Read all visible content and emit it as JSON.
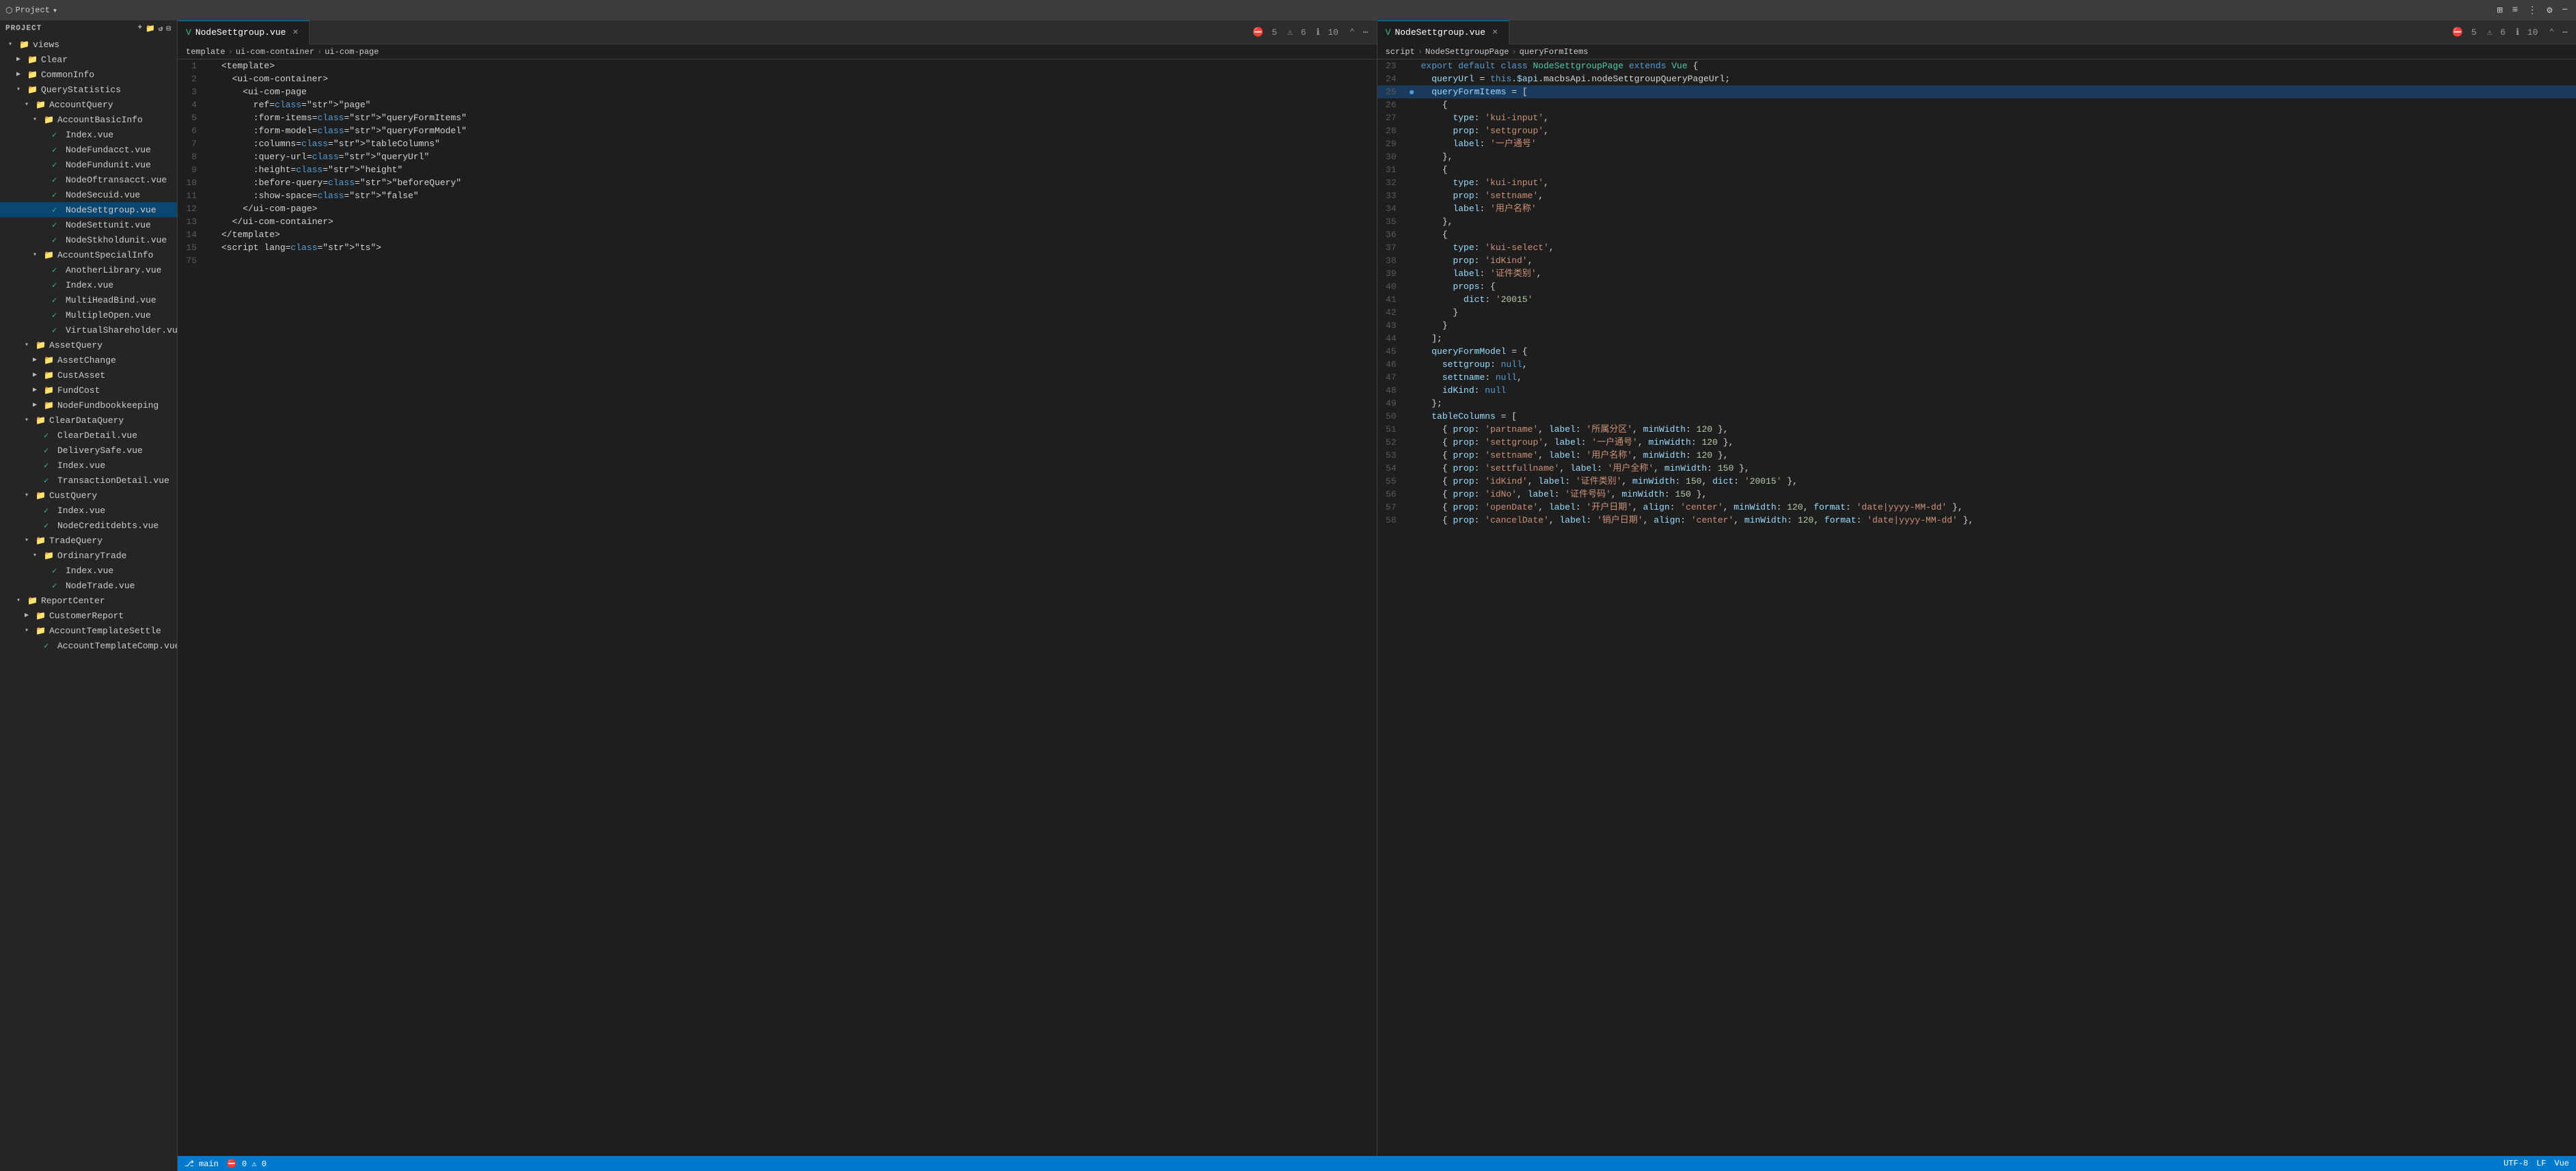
{
  "titleBar": {
    "projectLabel": "Project",
    "icons": [
      "grid-icon",
      "list-icon",
      "dots-icon",
      "settings-icon",
      "minus-icon"
    ]
  },
  "sidebar": {
    "header": "Project",
    "tree": [
      {
        "id": "views",
        "level": 1,
        "type": "folder",
        "label": "views",
        "expanded": true,
        "arrow": "▾"
      },
      {
        "id": "clear",
        "level": 2,
        "type": "folder",
        "label": "Clear",
        "expanded": false,
        "arrow": "▶"
      },
      {
        "id": "commoninfo",
        "level": 2,
        "type": "folder",
        "label": "CommonInfo",
        "expanded": false,
        "arrow": "▶"
      },
      {
        "id": "querystatistics",
        "level": 2,
        "type": "folder",
        "label": "QueryStatistics",
        "expanded": true,
        "arrow": "▾"
      },
      {
        "id": "accountquery",
        "level": 3,
        "type": "folder",
        "label": "AccountQuery",
        "expanded": true,
        "arrow": "▾"
      },
      {
        "id": "accountbasicinfo",
        "level": 4,
        "type": "folder",
        "label": "AccountBasicInfo",
        "expanded": true,
        "arrow": "▾"
      },
      {
        "id": "index-vue-1",
        "level": 5,
        "type": "vue",
        "label": "Index.vue"
      },
      {
        "id": "nodefundacct-vue",
        "level": 5,
        "type": "vue",
        "label": "NodeFundacct.vue"
      },
      {
        "id": "nodefundunit-vue",
        "level": 5,
        "type": "vue",
        "label": "NodeFundunit.vue"
      },
      {
        "id": "nodeoftransacct-vue",
        "level": 5,
        "type": "vue",
        "label": "NodeOftransacct.vue"
      },
      {
        "id": "nodesecuid-vue",
        "level": 5,
        "type": "vue",
        "label": "NodeSecuid.vue"
      },
      {
        "id": "nodesettgroup-vue",
        "level": 5,
        "type": "vue",
        "label": "NodeSettgroup.vue",
        "selected": true
      },
      {
        "id": "nodesetunit-vue",
        "level": 5,
        "type": "vue",
        "label": "NodeSettunit.vue"
      },
      {
        "id": "nodestkholdunit-vue",
        "level": 5,
        "type": "vue",
        "label": "NodeStkholdunit.vue"
      },
      {
        "id": "accountspecialinfo",
        "level": 4,
        "type": "folder",
        "label": "AccountSpecialInfo",
        "expanded": true,
        "arrow": "▾"
      },
      {
        "id": "anotherlibrary-vue",
        "level": 5,
        "type": "vue",
        "label": "AnotherLibrary.vue"
      },
      {
        "id": "index-vue-2",
        "level": 5,
        "type": "vue",
        "label": "Index.vue"
      },
      {
        "id": "multiheadbind-vue",
        "level": 5,
        "type": "vue",
        "label": "MultiHeadBind.vue"
      },
      {
        "id": "multipleopen-vue",
        "level": 5,
        "type": "vue",
        "label": "MultipleOpen.vue"
      },
      {
        "id": "virtualshareholder-vue",
        "level": 5,
        "type": "vue",
        "label": "VirtualShareholder.vue"
      },
      {
        "id": "assetquery",
        "level": 3,
        "type": "folder",
        "label": "AssetQuery",
        "expanded": true,
        "arrow": "▾"
      },
      {
        "id": "assetchange",
        "level": 4,
        "type": "folder",
        "label": "AssetChange",
        "expanded": false,
        "arrow": "▶"
      },
      {
        "id": "custasset",
        "level": 4,
        "type": "folder",
        "label": "CustAsset",
        "expanded": false,
        "arrow": "▶"
      },
      {
        "id": "fundcost",
        "level": 4,
        "type": "folder",
        "label": "FundCost",
        "expanded": false,
        "arrow": "▶"
      },
      {
        "id": "nodefundbookkeeping",
        "level": 4,
        "type": "folder",
        "label": "NodeFundbookkeeping",
        "expanded": false,
        "arrow": "▶"
      },
      {
        "id": "cleardataquery",
        "level": 3,
        "type": "folder",
        "label": "ClearDataQuery",
        "expanded": true,
        "arrow": "▾"
      },
      {
        "id": "cleardetail-vue",
        "level": 4,
        "type": "vue",
        "label": "ClearDetail.vue"
      },
      {
        "id": "deliverysafe-vue",
        "level": 4,
        "type": "vue",
        "label": "DeliverySafe.vue"
      },
      {
        "id": "index-vue-3",
        "level": 4,
        "type": "vue",
        "label": "Index.vue"
      },
      {
        "id": "transactiondetail-vue",
        "level": 4,
        "type": "vue",
        "label": "TransactionDetail.vue"
      },
      {
        "id": "custquery",
        "level": 3,
        "type": "folder",
        "label": "CustQuery",
        "expanded": true,
        "arrow": "▾"
      },
      {
        "id": "index-vue-4",
        "level": 4,
        "type": "vue",
        "label": "Index.vue"
      },
      {
        "id": "nodecreditdebts-vue",
        "level": 4,
        "type": "vue",
        "label": "NodeCreditdebts.vue"
      },
      {
        "id": "tradequery",
        "level": 3,
        "type": "folder",
        "label": "TradeQuery",
        "expanded": true,
        "arrow": "▾"
      },
      {
        "id": "ordinarytrade",
        "level": 4,
        "type": "folder",
        "label": "OrdinaryTrade",
        "expanded": true,
        "arrow": "▾"
      },
      {
        "id": "index-vue-5",
        "level": 5,
        "type": "vue",
        "label": "Index.vue"
      },
      {
        "id": "nodetrade-vue",
        "level": 5,
        "type": "vue",
        "label": "NodeTrade.vue"
      },
      {
        "id": "reportcenter",
        "level": 2,
        "type": "folder",
        "label": "ReportCenter",
        "expanded": true,
        "arrow": "▾"
      },
      {
        "id": "customerreport",
        "level": 3,
        "type": "folder",
        "label": "CustomerReport",
        "expanded": false,
        "arrow": "▶"
      },
      {
        "id": "accounttemplatesettle",
        "level": 3,
        "type": "folder",
        "label": "AccountTemplateSettle",
        "expanded": true,
        "arrow": "▾"
      },
      {
        "id": "accounttemplatecomp-vue",
        "level": 4,
        "type": "vue",
        "label": "AccountTemplateComp.vue"
      }
    ]
  },
  "leftEditor": {
    "tab": {
      "label": "NodeSettgroup.vue",
      "modified": false,
      "active": true
    },
    "badges": {
      "errors": "5",
      "warnings": "6",
      "info": "10"
    },
    "lines": [
      {
        "num": 1,
        "code": "<template>",
        "tokens": [
          {
            "t": "tag",
            "v": "<template>"
          }
        ]
      },
      {
        "num": 2,
        "code": "  <ui-com-container>",
        "tokens": [
          {
            "t": "op",
            "v": "  "
          },
          {
            "t": "tag",
            "v": "<ui-com-container>"
          }
        ]
      },
      {
        "num": 3,
        "code": "    <ui-com-page",
        "tokens": [
          {
            "t": "op",
            "v": "    "
          },
          {
            "t": "tag",
            "v": "<ui-com-page"
          }
        ]
      },
      {
        "num": 4,
        "code": "      ref=\"page\"",
        "tokens": [
          {
            "t": "op",
            "v": "      "
          },
          {
            "t": "attr",
            "v": "ref"
          },
          {
            "t": "op",
            "v": "="
          },
          {
            "t": "str",
            "v": "\"page\""
          }
        ]
      },
      {
        "num": 5,
        "code": "      :form-items=\"queryFormItems\"",
        "tokens": [
          {
            "t": "op",
            "v": "      "
          },
          {
            "t": "attr",
            "v": ":form-items"
          },
          {
            "t": "op",
            "v": "="
          },
          {
            "t": "str",
            "v": "\"queryFormItems\""
          }
        ]
      },
      {
        "num": 6,
        "code": "      :form-model=\"queryFormModel\"",
        "tokens": [
          {
            "t": "op",
            "v": "      "
          },
          {
            "t": "attr",
            "v": ":form-model"
          },
          {
            "t": "op",
            "v": "="
          },
          {
            "t": "str",
            "v": "\"queryFormModel\""
          }
        ]
      },
      {
        "num": 7,
        "code": "      :columns=\"tableColumns\"",
        "tokens": [
          {
            "t": "op",
            "v": "      "
          },
          {
            "t": "attr",
            "v": ":columns"
          },
          {
            "t": "op",
            "v": "="
          },
          {
            "t": "str",
            "v": "\"tableColumns\""
          }
        ]
      },
      {
        "num": 8,
        "code": "      :query-url=\"queryUrl\"",
        "tokens": [
          {
            "t": "op",
            "v": "      "
          },
          {
            "t": "attr",
            "v": ":query-url"
          },
          {
            "t": "op",
            "v": "="
          },
          {
            "t": "str",
            "v": "\"queryUrl\""
          }
        ]
      },
      {
        "num": 9,
        "code": "      :height=\"height\"",
        "tokens": [
          {
            "t": "op",
            "v": "      "
          },
          {
            "t": "attr",
            "v": ":height"
          },
          {
            "t": "op",
            "v": "="
          },
          {
            "t": "str",
            "v": "\"height\""
          }
        ]
      },
      {
        "num": 10,
        "code": "      :before-query=\"beforeQuery\"",
        "tokens": [
          {
            "t": "op",
            "v": "      "
          },
          {
            "t": "attr",
            "v": ":before-query"
          },
          {
            "t": "op",
            "v": "="
          },
          {
            "t": "str",
            "v": "\"beforeQuery\""
          }
        ]
      },
      {
        "num": 11,
        "code": "      :show-space=\"false\"",
        "tokens": [
          {
            "t": "op",
            "v": "      "
          },
          {
            "t": "attr",
            "v": ":show-space"
          },
          {
            "t": "op",
            "v": "="
          },
          {
            "t": "str",
            "v": "\"false\""
          }
        ]
      },
      {
        "num": 12,
        "code": "    </ui-com-page>",
        "tokens": [
          {
            "t": "op",
            "v": "    "
          },
          {
            "t": "tag",
            "v": "</ui-com-page>"
          }
        ]
      },
      {
        "num": 13,
        "code": "  </ui-com-container>",
        "tokens": [
          {
            "t": "op",
            "v": "  "
          },
          {
            "t": "tag",
            "v": "</ui-com-container>"
          }
        ]
      },
      {
        "num": 14,
        "code": "</template>",
        "tokens": [
          {
            "t": "tag",
            "v": "</template>"
          }
        ]
      },
      {
        "num": 15,
        "code": "<script lang=\"ts\">",
        "tokens": [
          {
            "t": "tag",
            "v": "<script"
          },
          {
            "t": "op",
            "v": " "
          },
          {
            "t": "attr",
            "v": "lang"
          },
          {
            "t": "op",
            "v": "="
          },
          {
            "t": "str",
            "v": "\"ts\""
          },
          {
            "t": "tag",
            "v": ">"
          }
        ]
      },
      {
        "num": 75,
        "code": ""
      },
      {
        "num": "",
        "code": ""
      }
    ],
    "breadcrumb": [
      "template",
      "ui-com-container",
      "ui-com-page"
    ]
  },
  "rightEditor": {
    "tab": {
      "label": "NodeSettgroup.vue",
      "modified": false,
      "active": true
    },
    "badges": {
      "errors": "5",
      "warnings": "6",
      "info": "10"
    },
    "lines": [
      {
        "num": 23,
        "code": "export default class NodeSettgroupPage extends Vue {",
        "highlight": false
      },
      {
        "num": 24,
        "code": "  queryUrl = this.$api.macbsApi.nodeSettgroupQueryPageUrl;",
        "highlight": false
      },
      {
        "num": 25,
        "code": "  queryFormItems = [",
        "highlight": true
      },
      {
        "num": 26,
        "code": "    {",
        "highlight": false
      },
      {
        "num": 27,
        "code": "      type: 'kui-input',",
        "highlight": false
      },
      {
        "num": 28,
        "code": "      prop: 'settgroup',",
        "highlight": false
      },
      {
        "num": 29,
        "code": "      label: '一户通号'",
        "highlight": false
      },
      {
        "num": 30,
        "code": "    },",
        "highlight": false
      },
      {
        "num": 31,
        "code": "    {",
        "highlight": false
      },
      {
        "num": 32,
        "code": "      type: 'kui-input',",
        "highlight": false
      },
      {
        "num": 33,
        "code": "      prop: 'settname',",
        "highlight": false
      },
      {
        "num": 34,
        "code": "      label: '用户名称'",
        "highlight": false
      },
      {
        "num": 35,
        "code": "    },",
        "highlight": false
      },
      {
        "num": 36,
        "code": "    {",
        "highlight": false
      },
      {
        "num": 37,
        "code": "      type: 'kui-select',",
        "highlight": false
      },
      {
        "num": 38,
        "code": "      prop: 'idKind',",
        "highlight": false
      },
      {
        "num": 39,
        "code": "      label: '证件类别',",
        "highlight": false
      },
      {
        "num": 40,
        "code": "      props: {",
        "highlight": false
      },
      {
        "num": 41,
        "code": "        dict: '20015'",
        "highlight": false
      },
      {
        "num": 42,
        "code": "      }",
        "highlight": false
      },
      {
        "num": 43,
        "code": "    }",
        "highlight": false
      },
      {
        "num": 44,
        "code": "  ];",
        "highlight": false
      },
      {
        "num": 45,
        "code": "  queryFormModel = {",
        "highlight": false
      },
      {
        "num": 46,
        "code": "    settgroup: null,",
        "highlight": false
      },
      {
        "num": 47,
        "code": "    settname: null,",
        "highlight": false
      },
      {
        "num": 48,
        "code": "    idKind: null",
        "highlight": false
      },
      {
        "num": 49,
        "code": "  };",
        "highlight": false
      },
      {
        "num": 50,
        "code": "  tableColumns = [",
        "highlight": false
      },
      {
        "num": 51,
        "code": "    { prop: 'partname', label: '所属分区', minWidth: 120 },",
        "highlight": false
      },
      {
        "num": 52,
        "code": "    { prop: 'settgroup', label: '一户通号', minWidth: 120 },",
        "highlight": false
      },
      {
        "num": 53,
        "code": "    { prop: 'settname', label: '用户名称', minWidth: 120 },",
        "highlight": false
      },
      {
        "num": 54,
        "code": "    { prop: 'settfullname', label: '用户全称', minWidth: 150 },",
        "highlight": false
      },
      {
        "num": 55,
        "code": "    { prop: 'idKind', label: '证件类别', minWidth: 150, dict: '20015' },",
        "highlight": false
      },
      {
        "num": 56,
        "code": "    { prop: 'idNo', label: '证件号码', minWidth: 150 },",
        "highlight": false
      },
      {
        "num": 57,
        "code": "    { prop: 'openDate', label: '开户日期', align: 'center', minWidth: 120, format: 'date|yyyy-MM-dd' },",
        "highlight": false
      },
      {
        "num": 58,
        "code": "    { prop: 'cancelDate', label: '销户日期', align: 'center', minWidth: 120, format: 'date|yyyy-MM-dd' },",
        "highlight": false
      }
    ],
    "breadcrumb": [
      "script",
      "NodeSettgroupPage",
      "queryFormItems"
    ]
  },
  "statusBar": {
    "branch": "main",
    "errors": "0",
    "warnings": "0",
    "encoding": "UTF-8",
    "lineEnding": "LF",
    "language": "Vue"
  }
}
